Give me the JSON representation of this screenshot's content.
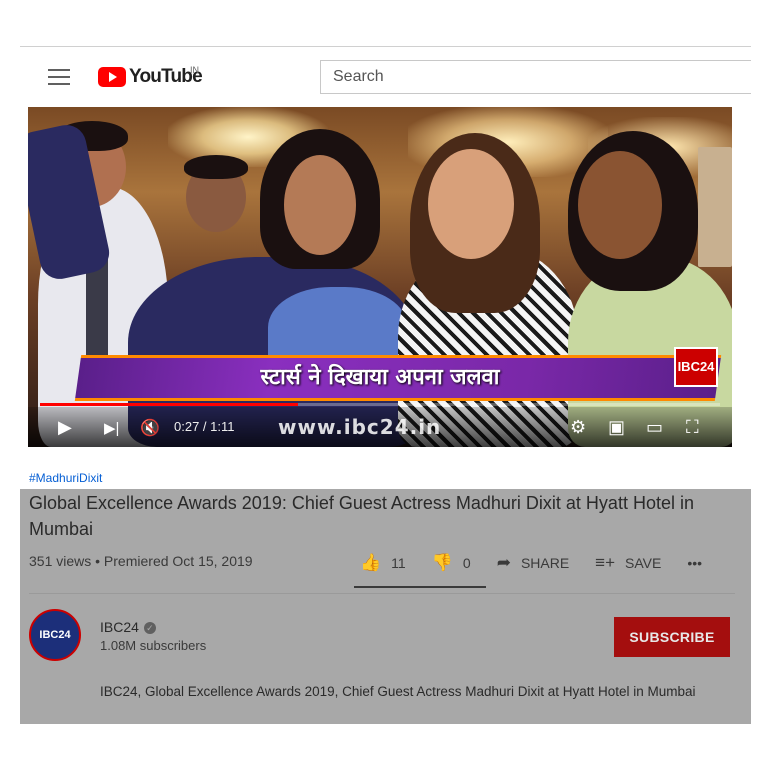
{
  "header": {
    "logo_text": "YouTube",
    "country_code": "IN",
    "search_placeholder": "Search"
  },
  "video": {
    "banner_text": "स्टार्स ने दिखाया अपना जलवा",
    "channel_badge": "IBC24",
    "watermark_url": "www.ibc24.in",
    "current_time": "0:27",
    "duration": "1:11",
    "time_display": "0:27 / 1:11",
    "progress_fraction": 0.38
  },
  "info": {
    "hashtag": "#MadhuriDixit",
    "title": "Global Excellence Awards 2019: Chief Guest Actress Madhuri Dixit at Hyatt Hotel in Mumbai",
    "meta": "351 views • Premiered Oct 15, 2019",
    "likes": "11",
    "dislikes": "0",
    "share_label": "SHARE",
    "save_label": "SAVE",
    "more_label": "•••"
  },
  "channel": {
    "avatar_text": "IBC24",
    "name": "IBC24",
    "subscribers": "1.08M subscribers",
    "subscribe_label": "SUBSCRIBE"
  },
  "description": "IBC24, Global Excellence Awards 2019, Chief Guest Actress Madhuri Dixit at Hyatt Hotel in Mumbai",
  "colors": {
    "brand_red": "#ff0000",
    "subscribe_bg": "#a40e0e",
    "link_blue": "#065fd4",
    "overlay_gray": "#a8a8a8"
  }
}
